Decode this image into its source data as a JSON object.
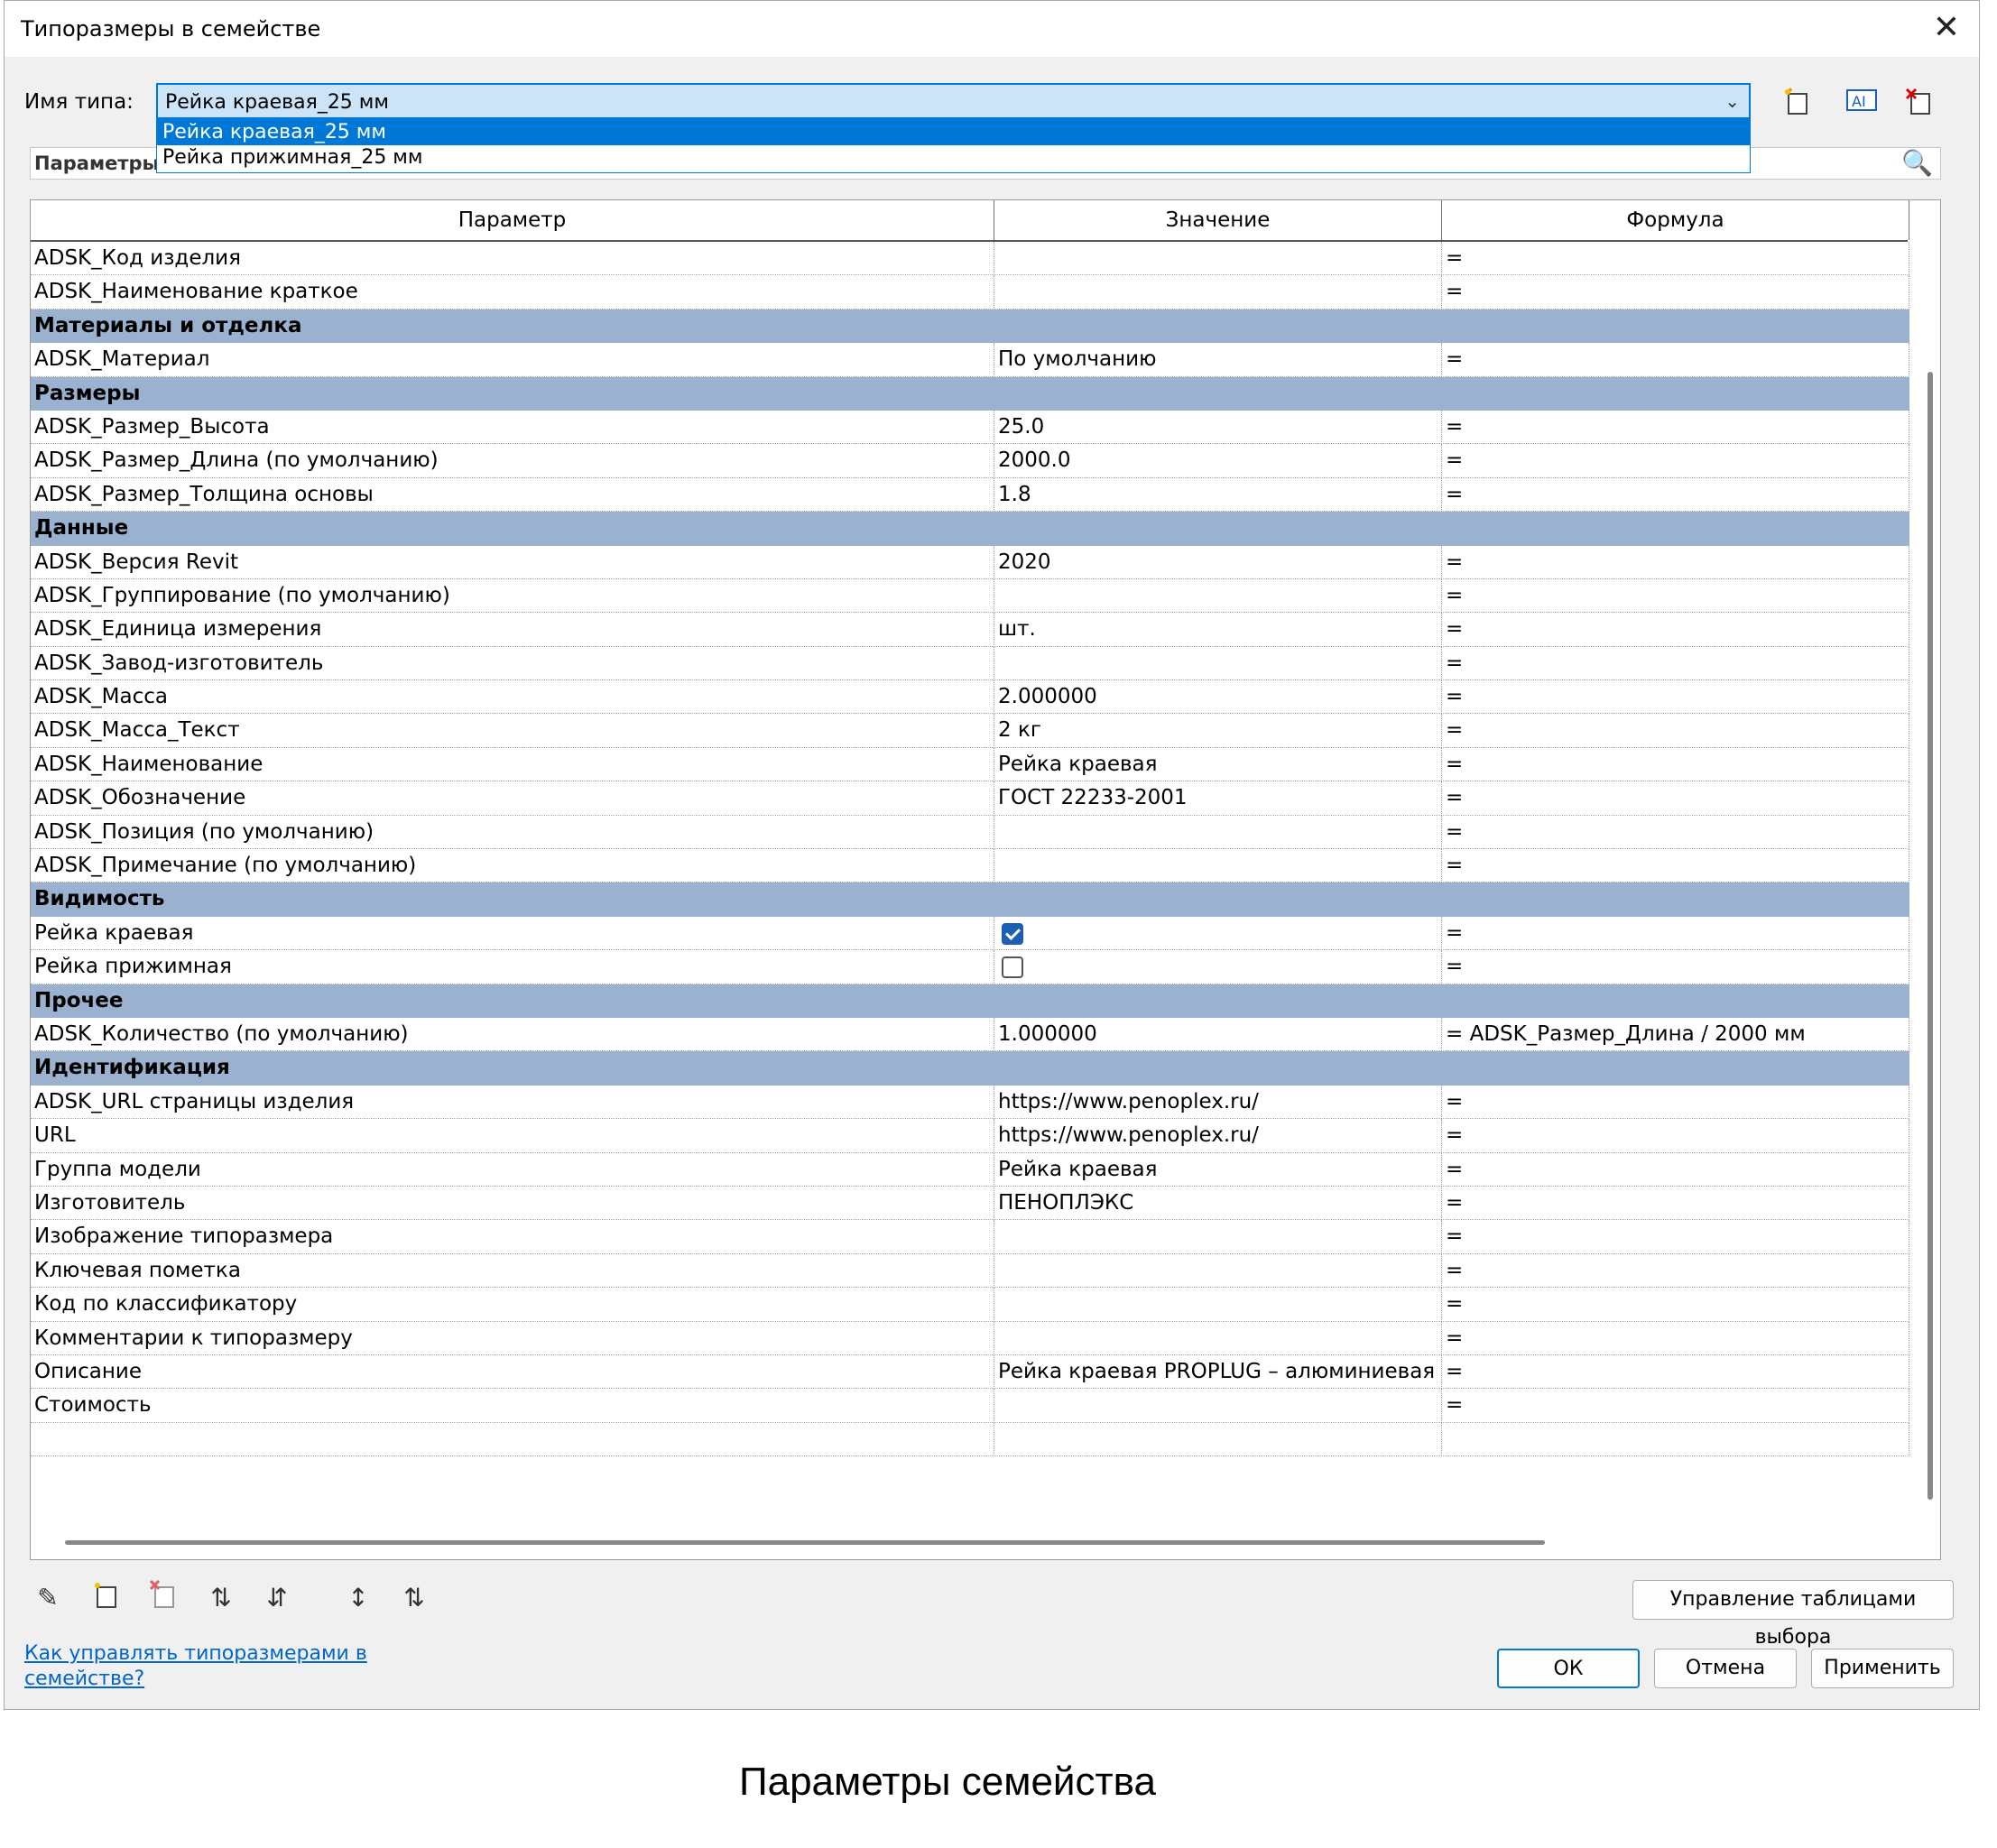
{
  "window": {
    "title": "Типоразмеры в семействе",
    "close_glyph": "✕"
  },
  "type_name": {
    "label": "Имя типа:",
    "value": "Рейка краевая_25 мм",
    "options": [
      "Рейка краевая_25 мм",
      "Рейка прижимная_25 мм"
    ]
  },
  "search": {
    "placeholder": "Параметры п"
  },
  "icons": {
    "new_type": "new-type-icon",
    "rename_type": "rename-type-icon",
    "delete_type": "delete-type-icon",
    "search": "search-icon"
  },
  "columns": [
    "Параметр",
    "Значение",
    "Формула"
  ],
  "rows": [
    {
      "kind": "row",
      "param": "ADSK_Код изделия",
      "value": "",
      "formula": "="
    },
    {
      "kind": "row",
      "param": "ADSK_Наименование краткое",
      "value": "",
      "formula": "="
    },
    {
      "kind": "group",
      "param": "Материалы и отделка"
    },
    {
      "kind": "row",
      "param": "ADSK_Материал",
      "value": "По умолчанию",
      "formula": "="
    },
    {
      "kind": "group",
      "param": "Размеры"
    },
    {
      "kind": "row",
      "param": "ADSK_Размер_Высота",
      "value": "25.0",
      "formula": "="
    },
    {
      "kind": "row",
      "param": "ADSK_Размер_Длина (по умолчанию)",
      "value": "2000.0",
      "formula": "="
    },
    {
      "kind": "row",
      "param": "ADSK_Размер_Толщина основы",
      "value": "1.8",
      "formula": "="
    },
    {
      "kind": "group",
      "param": "Данные"
    },
    {
      "kind": "row",
      "param": "ADSK_Версия Revit",
      "value": "2020",
      "formula": "="
    },
    {
      "kind": "row",
      "param": "ADSK_Группирование (по умолчанию)",
      "value": "",
      "formula": "="
    },
    {
      "kind": "row",
      "param": "ADSK_Единица измерения",
      "value": "шт.",
      "formula": "="
    },
    {
      "kind": "row",
      "param": "ADSK_Завод-изготовитель",
      "value": "",
      "formula": "="
    },
    {
      "kind": "row",
      "param": "ADSK_Масса",
      "value": "2.000000",
      "formula": "="
    },
    {
      "kind": "row",
      "param": "ADSK_Масса_Текст",
      "value": "2 кг",
      "formula": "="
    },
    {
      "kind": "row",
      "param": "ADSK_Наименование",
      "value": "Рейка краевая",
      "formula": "="
    },
    {
      "kind": "row",
      "param": "ADSK_Обозначение",
      "value": "ГОСТ 22233-2001",
      "formula": "="
    },
    {
      "kind": "row",
      "param": "ADSK_Позиция (по умолчанию)",
      "value": "",
      "formula": "="
    },
    {
      "kind": "row",
      "param": "ADSK_Примечание (по умолчанию)",
      "value": "",
      "formula": "="
    },
    {
      "kind": "group",
      "param": "Видимость"
    },
    {
      "kind": "check",
      "param": "Рейка краевая",
      "checked": true,
      "formula": "="
    },
    {
      "kind": "check",
      "param": "Рейка прижимная",
      "checked": false,
      "formula": "="
    },
    {
      "kind": "group",
      "param": "Прочее"
    },
    {
      "kind": "row",
      "param": "ADSK_Количество (по умолчанию)",
      "value": "1.000000",
      "formula": "= ADSK_Размер_Длина / 2000 мм"
    },
    {
      "kind": "group",
      "param": "Идентификация"
    },
    {
      "kind": "row",
      "param": "ADSK_URL страницы изделия",
      "value": "https://www.penoplex.ru/",
      "formula": "="
    },
    {
      "kind": "row",
      "param": "URL",
      "value": "https://www.penoplex.ru/",
      "formula": "="
    },
    {
      "kind": "row",
      "param": "Группа модели",
      "value": "Рейка краевая",
      "formula": "="
    },
    {
      "kind": "row",
      "param": "Изготовитель",
      "value": "ПЕНОПЛЭКС",
      "formula": "="
    },
    {
      "kind": "row",
      "param": "Изображение типоразмера",
      "value": "",
      "formula": "="
    },
    {
      "kind": "row",
      "param": "Ключевая пометка",
      "value": "",
      "formula": "="
    },
    {
      "kind": "row",
      "param": "Код по классификатору",
      "value": "",
      "formula": "="
    },
    {
      "kind": "row",
      "param": "Комментарии к типоразмеру",
      "value": "",
      "formula": "="
    },
    {
      "kind": "row",
      "param": "Описание",
      "value": "Рейка краевая PROPLUG – алюминиевая р",
      "formula": "="
    },
    {
      "kind": "row",
      "param": "Стоимость",
      "value": "",
      "formula": "="
    },
    {
      "kind": "row",
      "param": "",
      "value": "",
      "formula": ""
    }
  ],
  "bottom_toolbar": {
    "icons": [
      "pencil-icon",
      "new-param-icon",
      "delete-param-icon",
      "move-up-icon",
      "move-down-icon",
      "sort-asc-icon",
      "sort-desc-icon"
    ],
    "lookup_button": "Управление таблицами выбора"
  },
  "help_link": "Как управлять типоразмерами в семействе?",
  "buttons": {
    "ok": "ОК",
    "cancel": "Отмена",
    "apply": "Применить"
  },
  "caption": "Параметры семейства",
  "colors": {
    "group_bg": "#9ab2cf",
    "selected": "#0078d7",
    "select_bg": "#cce4f7",
    "link": "#0066cc"
  }
}
